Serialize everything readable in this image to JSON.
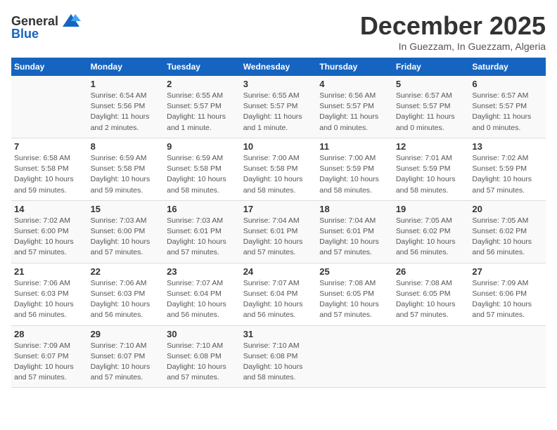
{
  "header": {
    "logo_general": "General",
    "logo_blue": "Blue",
    "month": "December 2025",
    "location": "In Guezzam, In Guezzam, Algeria"
  },
  "weekdays": [
    "Sunday",
    "Monday",
    "Tuesday",
    "Wednesday",
    "Thursday",
    "Friday",
    "Saturday"
  ],
  "weeks": [
    [
      {
        "day": "",
        "info": ""
      },
      {
        "day": "1",
        "info": "Sunrise: 6:54 AM\nSunset: 5:56 PM\nDaylight: 11 hours\nand 2 minutes."
      },
      {
        "day": "2",
        "info": "Sunrise: 6:55 AM\nSunset: 5:57 PM\nDaylight: 11 hours\nand 1 minute."
      },
      {
        "day": "3",
        "info": "Sunrise: 6:55 AM\nSunset: 5:57 PM\nDaylight: 11 hours\nand 1 minute."
      },
      {
        "day": "4",
        "info": "Sunrise: 6:56 AM\nSunset: 5:57 PM\nDaylight: 11 hours\nand 0 minutes."
      },
      {
        "day": "5",
        "info": "Sunrise: 6:57 AM\nSunset: 5:57 PM\nDaylight: 11 hours\nand 0 minutes."
      },
      {
        "day": "6",
        "info": "Sunrise: 6:57 AM\nSunset: 5:57 PM\nDaylight: 11 hours\nand 0 minutes."
      }
    ],
    [
      {
        "day": "7",
        "info": "Sunrise: 6:58 AM\nSunset: 5:58 PM\nDaylight: 10 hours\nand 59 minutes."
      },
      {
        "day": "8",
        "info": "Sunrise: 6:59 AM\nSunset: 5:58 PM\nDaylight: 10 hours\nand 59 minutes."
      },
      {
        "day": "9",
        "info": "Sunrise: 6:59 AM\nSunset: 5:58 PM\nDaylight: 10 hours\nand 58 minutes."
      },
      {
        "day": "10",
        "info": "Sunrise: 7:00 AM\nSunset: 5:58 PM\nDaylight: 10 hours\nand 58 minutes."
      },
      {
        "day": "11",
        "info": "Sunrise: 7:00 AM\nSunset: 5:59 PM\nDaylight: 10 hours\nand 58 minutes."
      },
      {
        "day": "12",
        "info": "Sunrise: 7:01 AM\nSunset: 5:59 PM\nDaylight: 10 hours\nand 58 minutes."
      },
      {
        "day": "13",
        "info": "Sunrise: 7:02 AM\nSunset: 5:59 PM\nDaylight: 10 hours\nand 57 minutes."
      }
    ],
    [
      {
        "day": "14",
        "info": "Sunrise: 7:02 AM\nSunset: 6:00 PM\nDaylight: 10 hours\nand 57 minutes."
      },
      {
        "day": "15",
        "info": "Sunrise: 7:03 AM\nSunset: 6:00 PM\nDaylight: 10 hours\nand 57 minutes."
      },
      {
        "day": "16",
        "info": "Sunrise: 7:03 AM\nSunset: 6:01 PM\nDaylight: 10 hours\nand 57 minutes."
      },
      {
        "day": "17",
        "info": "Sunrise: 7:04 AM\nSunset: 6:01 PM\nDaylight: 10 hours\nand 57 minutes."
      },
      {
        "day": "18",
        "info": "Sunrise: 7:04 AM\nSunset: 6:01 PM\nDaylight: 10 hours\nand 57 minutes."
      },
      {
        "day": "19",
        "info": "Sunrise: 7:05 AM\nSunset: 6:02 PM\nDaylight: 10 hours\nand 56 minutes."
      },
      {
        "day": "20",
        "info": "Sunrise: 7:05 AM\nSunset: 6:02 PM\nDaylight: 10 hours\nand 56 minutes."
      }
    ],
    [
      {
        "day": "21",
        "info": "Sunrise: 7:06 AM\nSunset: 6:03 PM\nDaylight: 10 hours\nand 56 minutes."
      },
      {
        "day": "22",
        "info": "Sunrise: 7:06 AM\nSunset: 6:03 PM\nDaylight: 10 hours\nand 56 minutes."
      },
      {
        "day": "23",
        "info": "Sunrise: 7:07 AM\nSunset: 6:04 PM\nDaylight: 10 hours\nand 56 minutes."
      },
      {
        "day": "24",
        "info": "Sunrise: 7:07 AM\nSunset: 6:04 PM\nDaylight: 10 hours\nand 56 minutes."
      },
      {
        "day": "25",
        "info": "Sunrise: 7:08 AM\nSunset: 6:05 PM\nDaylight: 10 hours\nand 57 minutes."
      },
      {
        "day": "26",
        "info": "Sunrise: 7:08 AM\nSunset: 6:05 PM\nDaylight: 10 hours\nand 57 minutes."
      },
      {
        "day": "27",
        "info": "Sunrise: 7:09 AM\nSunset: 6:06 PM\nDaylight: 10 hours\nand 57 minutes."
      }
    ],
    [
      {
        "day": "28",
        "info": "Sunrise: 7:09 AM\nSunset: 6:07 PM\nDaylight: 10 hours\nand 57 minutes."
      },
      {
        "day": "29",
        "info": "Sunrise: 7:10 AM\nSunset: 6:07 PM\nDaylight: 10 hours\nand 57 minutes."
      },
      {
        "day": "30",
        "info": "Sunrise: 7:10 AM\nSunset: 6:08 PM\nDaylight: 10 hours\nand 57 minutes."
      },
      {
        "day": "31",
        "info": "Sunrise: 7:10 AM\nSunset: 6:08 PM\nDaylight: 10 hours\nand 58 minutes."
      },
      {
        "day": "",
        "info": ""
      },
      {
        "day": "",
        "info": ""
      },
      {
        "day": "",
        "info": ""
      }
    ]
  ]
}
